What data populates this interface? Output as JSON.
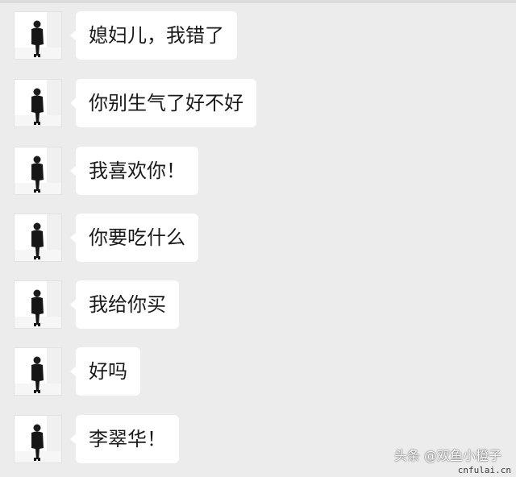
{
  "messages": [
    {
      "text": "媳妇儿，我错了",
      "avatar": "person-avatar-icon"
    },
    {
      "text": "你别生气了好不好",
      "avatar": "person-avatar-icon"
    },
    {
      "text": "我喜欢你！",
      "avatar": "person-avatar-icon"
    },
    {
      "text": "你要吃什么",
      "avatar": "person-avatar-icon"
    },
    {
      "text": "我给你买",
      "avatar": "person-avatar-icon"
    },
    {
      "text": "好吗",
      "avatar": "person-avatar-icon"
    },
    {
      "text": "李翠华！",
      "avatar": "person-avatar-icon"
    }
  ],
  "watermark": {
    "source": "头条 @双鱼小橙子",
    "site": "cnfulai.cn"
  },
  "colors": {
    "background": "#ececec",
    "bubble": "#ffffff",
    "text": "#1a1a1a"
  }
}
